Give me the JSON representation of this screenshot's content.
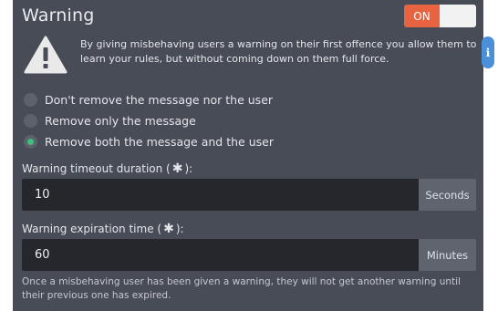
{
  "section": {
    "title": "Warning",
    "toggle_label": "ON",
    "toggle_checked": true,
    "description": "By giving misbehaving users a warning on their first offence you allow them to learn your rules, but without coming down on them full force."
  },
  "options": [
    {
      "label": "Don't remove the message nor the user",
      "selected": false
    },
    {
      "label": "Remove only the message",
      "selected": false
    },
    {
      "label": "Remove both the message and the user",
      "selected": true
    }
  ],
  "timeout": {
    "label_prefix": "Warning timeout duration (",
    "required_mark": "✱",
    "label_suffix": "):",
    "value": "10",
    "unit": "Seconds"
  },
  "expiration": {
    "label_prefix": "Warning expiration time (",
    "required_mark": "✱",
    "label_suffix": "):",
    "value": "60",
    "unit": "Minutes"
  },
  "footnote": "Once a misbehaving user has been given a warning, they will not get another warning until their previous one has expired.",
  "info_tab": {
    "label": "i"
  },
  "colors": {
    "panel": "#474c56",
    "accent_on": "#e8633f",
    "radio_selected": "#3ec07a",
    "input_bg": "#25272d",
    "info_tab": "#4a90d9"
  }
}
